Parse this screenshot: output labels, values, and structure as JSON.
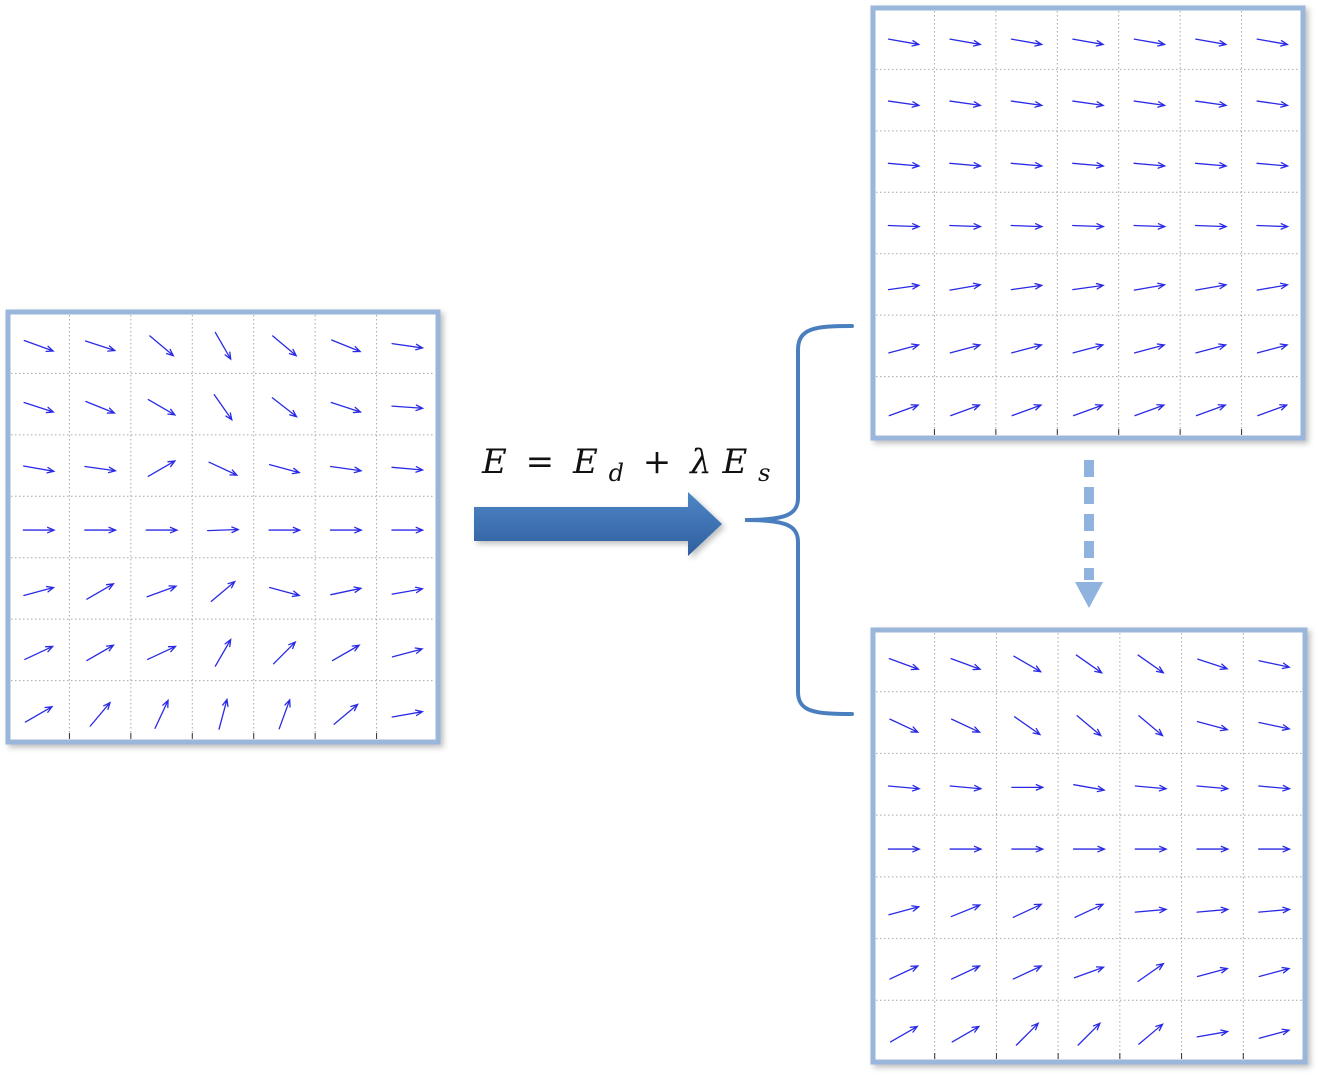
{
  "equation": {
    "lhs": "E",
    "equals": "=",
    "term1": "E",
    "term1_sub": "d",
    "plus": "+",
    "term2_coef": "λ",
    "term2": "E",
    "term2_sub": "s"
  },
  "colors": {
    "frame": "#9ab6da",
    "vector": "#2b2be6",
    "main_arrow": "#3a71b8",
    "brace": "#4a7fbf",
    "dashed_arrow": "#8fb3de",
    "grid": "#a8a8a8"
  },
  "fields": {
    "input_field": [
      [
        -20,
        -18,
        -40,
        -60,
        -40,
        -22,
        -8
      ],
      [
        -18,
        -22,
        -30,
        -55,
        -38,
        -18,
        -4
      ],
      [
        -10,
        -8,
        30,
        -25,
        -15,
        -8,
        -5
      ],
      [
        0,
        0,
        0,
        2,
        0,
        0,
        0
      ],
      [
        15,
        30,
        20,
        40,
        -15,
        12,
        10
      ],
      [
        25,
        30,
        25,
        60,
        45,
        30,
        15
      ],
      [
        30,
        50,
        65,
        75,
        70,
        40,
        10
      ]
    ],
    "smooth_result": [
      [
        -10,
        -10,
        -10,
        -10,
        -10,
        -10,
        -10
      ],
      [
        -8,
        -8,
        -8,
        -8,
        -8,
        -8,
        -8
      ],
      [
        -5,
        -5,
        -5,
        -5,
        -5,
        -5,
        -5
      ],
      [
        -2,
        -2,
        -2,
        -2,
        -2,
        -2,
        -2
      ],
      [
        8,
        10,
        8,
        8,
        10,
        10,
        10
      ],
      [
        15,
        15,
        15,
        15,
        15,
        15,
        15
      ],
      [
        20,
        20,
        20,
        20,
        20,
        20,
        20
      ]
    ],
    "preserved_result": [
      [
        -20,
        -20,
        -30,
        -35,
        -35,
        -18,
        -12
      ],
      [
        -25,
        -25,
        -35,
        -40,
        -40,
        -15,
        -12
      ],
      [
        -5,
        -5,
        0,
        -10,
        -5,
        -5,
        -5
      ],
      [
        0,
        0,
        0,
        0,
        0,
        0,
        0
      ],
      [
        15,
        22,
        25,
        25,
        5,
        5,
        5
      ],
      [
        25,
        25,
        25,
        20,
        35,
        15,
        15
      ],
      [
        30,
        30,
        45,
        45,
        40,
        10,
        15
      ]
    ]
  }
}
